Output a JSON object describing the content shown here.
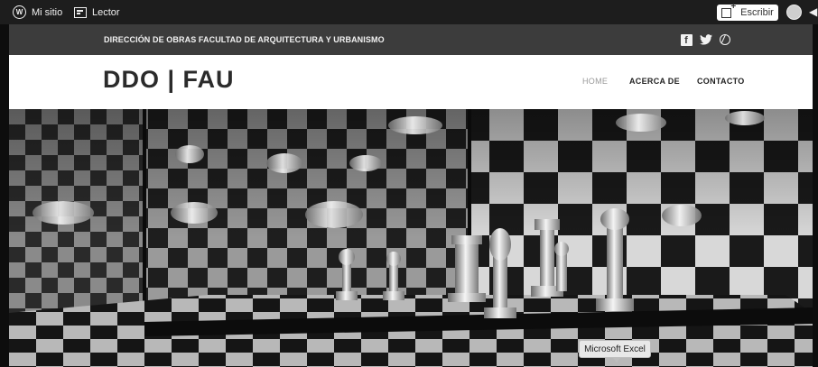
{
  "adminbar": {
    "my_site_label": "Mi sitio",
    "reader_label": "Lector",
    "write_label": "Escribir"
  },
  "topbar": {
    "tagline": "DIRECCIÓN DE OBRAS FACULTAD DE ARQUITECTURA Y URBANISMO",
    "social_icons": [
      "facebook-icon",
      "twitter-icon",
      "dribbble-icon"
    ]
  },
  "header": {
    "site_title": "DDO | FAU",
    "nav": {
      "home": "HOME",
      "about": "ACERCA DE",
      "contact": "CONTACTO"
    }
  },
  "tooltip": {
    "text": "Microsoft Excel"
  },
  "colors": {
    "adminbar_bg": "#1d1d1d",
    "topbar_bg": "#3c3c3c",
    "title_color": "#2b2b2b",
    "nav_active": "#999999"
  }
}
